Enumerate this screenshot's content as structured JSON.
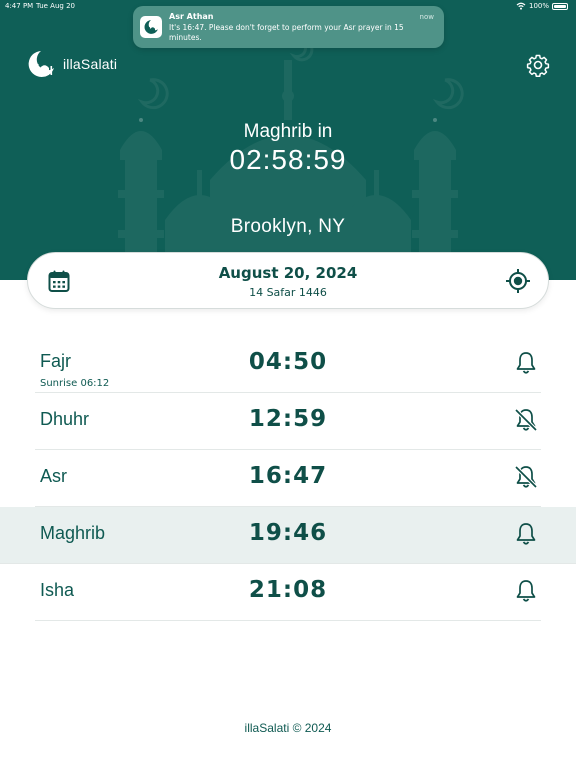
{
  "status_bar": {
    "time": "4:47 PM",
    "date": "Tue Aug 20",
    "battery": "100%"
  },
  "notification": {
    "title": "Asr Athan",
    "body": "It's 16:47. Please don't forget to perform your Asr prayer in 15 minutes.",
    "time": "now"
  },
  "app": {
    "name": "illaSalati"
  },
  "next_prayer": {
    "label": "Maghrib in",
    "countdown": "02:58:59"
  },
  "location": "Brooklyn, NY",
  "date": {
    "gregorian": "August 20, 2024",
    "hijri": "14 Safar 1446"
  },
  "prayers": [
    {
      "name": "Fajr",
      "time": "04:50",
      "sub": "Sunrise 06:12",
      "notifications": "on",
      "active": false
    },
    {
      "name": "Dhuhr",
      "time": "12:59",
      "notifications": "off",
      "active": false
    },
    {
      "name": "Asr",
      "time": "16:47",
      "notifications": "off",
      "active": false
    },
    {
      "name": "Maghrib",
      "time": "19:46",
      "notifications": "on",
      "active": true
    },
    {
      "name": "Isha",
      "time": "21:08",
      "notifications": "on",
      "active": false
    }
  ],
  "footer": "illaSalati © 2024",
  "colors": {
    "brand": "#0f5f57",
    "notification_bg": "#4f9388",
    "active_row": "#e9f0ef"
  },
  "icons": {
    "logo": "crescent-mosque-icon",
    "settings": "gear-icon",
    "calendar": "calendar-icon",
    "locate": "crosshair-location-icon",
    "bell_on": "bell-icon",
    "bell_off": "bell-off-icon",
    "wifi": "wifi-icon",
    "battery": "battery-icon"
  }
}
